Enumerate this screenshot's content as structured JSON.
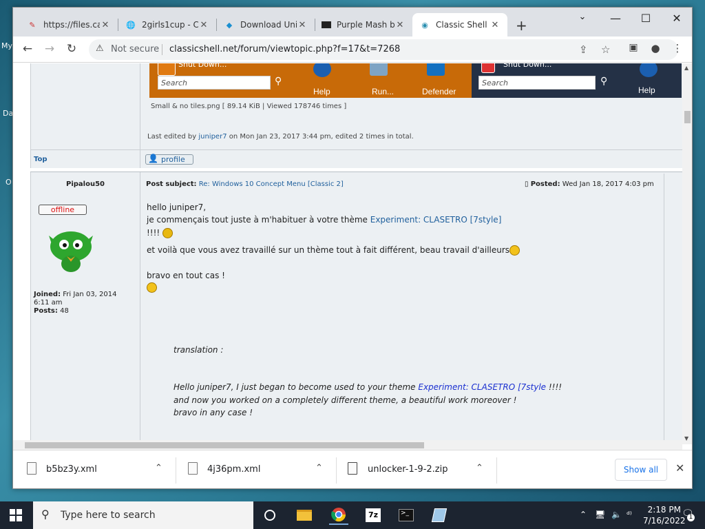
{
  "desktop": {
    "labels": [
      "My",
      "Da",
      "O"
    ]
  },
  "browser": {
    "tabs": [
      {
        "label": "https://files.ca",
        "icon": "file-icon"
      },
      {
        "label": "2girls1cup - C",
        "icon": "globe-icon"
      },
      {
        "label": "Download Uni",
        "icon": "download-site-icon"
      },
      {
        "label": "Purple Mash b",
        "icon": "purple-mash-icon"
      },
      {
        "label": "Classic Shell -",
        "icon": "shell-icon",
        "active": true
      }
    ],
    "new_tab": "+",
    "window_controls": {
      "minimize": "⌄  —",
      "maximize": "☐",
      "close": "✕"
    },
    "address": {
      "security": "Not secure",
      "url": "classicshell.net/forum/viewtopic.php?f=17&t=7268"
    }
  },
  "page": {
    "banner": {
      "left_search_placeholder": "Search",
      "right_search_placeholder": "Search",
      "shutdown_left": "Shut Down...",
      "shutdown_right": "Shut Down...",
      "help": "Help",
      "run": "Run...",
      "defender": "Defender",
      "help_right": "Help"
    },
    "attachment_meta": "Small & no tiles.png [ 89.14 KiB | Viewed 178746 times ]",
    "last_edited": {
      "prefix": "Last edited by ",
      "user": "juniper7",
      "suffix": " on Mon Jan 23, 2017 3:44 pm, edited 2 times in total."
    },
    "top_link": "Top",
    "profile_button": "profile",
    "post": {
      "author": "Pipalou50",
      "status": "offline",
      "joined_label": "Joined:",
      "joined_value": "Fri Jan 03, 2014",
      "joined_time": "6:11 am",
      "posts_label": "Posts:",
      "posts_value": "48",
      "subject_label": "Post subject:",
      "subject_value": "Re: Windows 10 Concept Menu [Classic 2]",
      "posted_label": "Posted:",
      "posted_value": "Wed Jan 18, 2017 4:03 pm",
      "lines": {
        "l1": "hello juniper7,",
        "l2_prefix": "je commençais tout juste à m'habituer à votre thème ",
        "l2_link": "Experiment: CLASETRO [7style]",
        "l3": "!!!!",
        "l4": "et voilà que vous avez travaillé sur un thème tout à fait différent, beau travail d'ailleurs",
        "l5": "bravo en tout cas !",
        "t1": "translation :",
        "t2_prefix": "Hello juniper7, I just began to become used to your theme ",
        "t2_link": "Experiment: CLASETRO [7style",
        "t2_suffix": " !!!!",
        "t3": "and now you worked on a completely different theme, a beautiful work moreover !",
        "t4": "bravo in any case !"
      }
    }
  },
  "downloads": {
    "items": [
      {
        "name": "b5bz3y.xml"
      },
      {
        "name": "4j36pm.xml"
      },
      {
        "name": "unlocker-1-9-2.zip"
      }
    ],
    "show_all": "Show all"
  },
  "taskbar": {
    "search_placeholder": "Type here to search",
    "time": "2:18 PM",
    "date": "7/16/2022",
    "notification_count": "1"
  },
  "colors": {
    "accent_blue": "#1a73e8",
    "link": "#1f5f9c",
    "offline_red": "#dd1111",
    "banner_orange": "#c86a08",
    "banner_dark": "#243146"
  }
}
